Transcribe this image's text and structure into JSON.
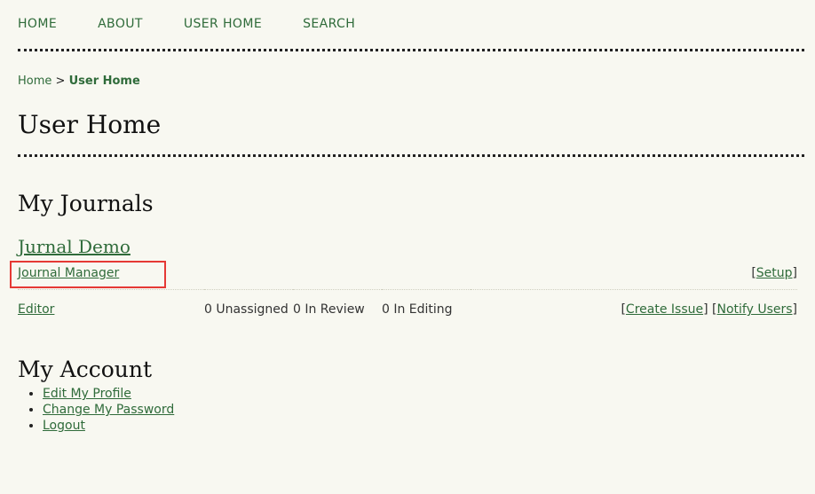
{
  "nav": {
    "home": "HOME",
    "about": "ABOUT",
    "user_home": "USER HOME",
    "search": "SEARCH"
  },
  "breadcrumb": {
    "home": "Home",
    "separator": ">",
    "current": "User Home"
  },
  "page_title": "User Home",
  "journals": {
    "section_title": "My Journals",
    "journal_name": "Jurnal Demo",
    "roles": [
      {
        "label": "Journal Manager",
        "actions": [
          "Setup"
        ]
      },
      {
        "label": "Editor",
        "stats": [
          "0 Unassigned",
          "0 In Review",
          "0 In Editing"
        ],
        "actions": [
          "Create Issue",
          "Notify Users"
        ]
      }
    ]
  },
  "account": {
    "section_title": "My Account",
    "items": [
      "Edit My Profile",
      "Change My Password",
      "Logout"
    ]
  },
  "colors": {
    "link": "#2f6b3a",
    "background": "#f8f8f1",
    "highlight": "#e53935"
  }
}
